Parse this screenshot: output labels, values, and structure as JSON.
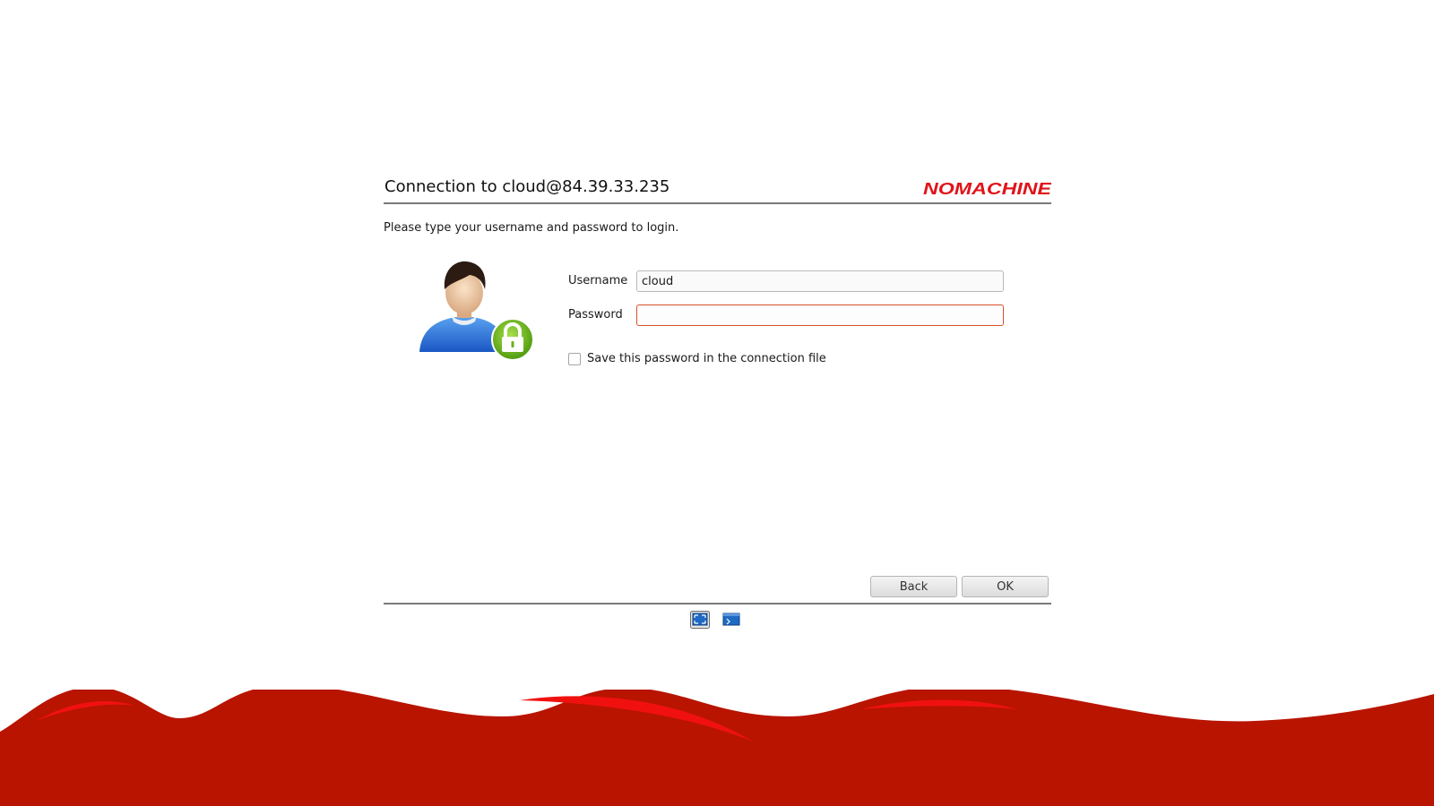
{
  "header": {
    "title": "Connection to cloud@84.39.33.235",
    "logo_text": "NOMACHINE",
    "logo_color": "#e0141a"
  },
  "instruction": "Please type your username and password to login.",
  "form": {
    "username_label": "Username",
    "username_value": "cloud",
    "password_label": "Password",
    "password_value": "",
    "save_password_label": "Save this password in the connection file",
    "save_password_checked": false
  },
  "buttons": {
    "back": "Back",
    "ok": "OK"
  },
  "view_icons": [
    "fullscreen-view-icon",
    "window-view-icon"
  ],
  "colors": {
    "brand_red": "#b81400",
    "focus_border": "#d8502a",
    "lock_green": "#7cc21e"
  }
}
